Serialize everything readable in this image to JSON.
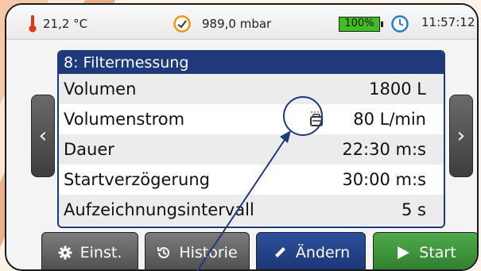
{
  "status": {
    "temperature": "21,2 °C",
    "pressure": "989,0 mbar",
    "battery": "100%",
    "time": "11:57:12"
  },
  "panel": {
    "title": "8: Filtermessung",
    "rows": [
      {
        "label": "Volumen",
        "value": "1800 L"
      },
      {
        "label": "Volumenstrom",
        "value": "80 L/min"
      },
      {
        "label": "Dauer",
        "value": "22:30 m:s"
      },
      {
        "label": "Startverzögerung",
        "value": "30:00 m:s"
      },
      {
        "label": "Aufzeichnungsintervall",
        "value": "5 s"
      }
    ]
  },
  "buttons": {
    "settings": "Einst.",
    "history": "Historie",
    "edit": "Ändern",
    "start": "Start"
  },
  "icons": {
    "temperature": "thermometer-icon",
    "pressure": "gauge-icon",
    "battery": "battery-icon",
    "time": "clock-icon",
    "flow": "filter-holder-icon",
    "settings": "gear-icon",
    "history": "history-icon",
    "edit": "pencil-icon",
    "start": "play-icon",
    "prev": "chevron-left-icon",
    "next": "chevron-right-icon"
  },
  "colors": {
    "accent": "#1f3a7a",
    "start": "#3c9438",
    "battery": "#3fbf1f",
    "thermometer": "#e0351c",
    "gauge": "#e89a10",
    "clock": "#2a7ec8"
  }
}
